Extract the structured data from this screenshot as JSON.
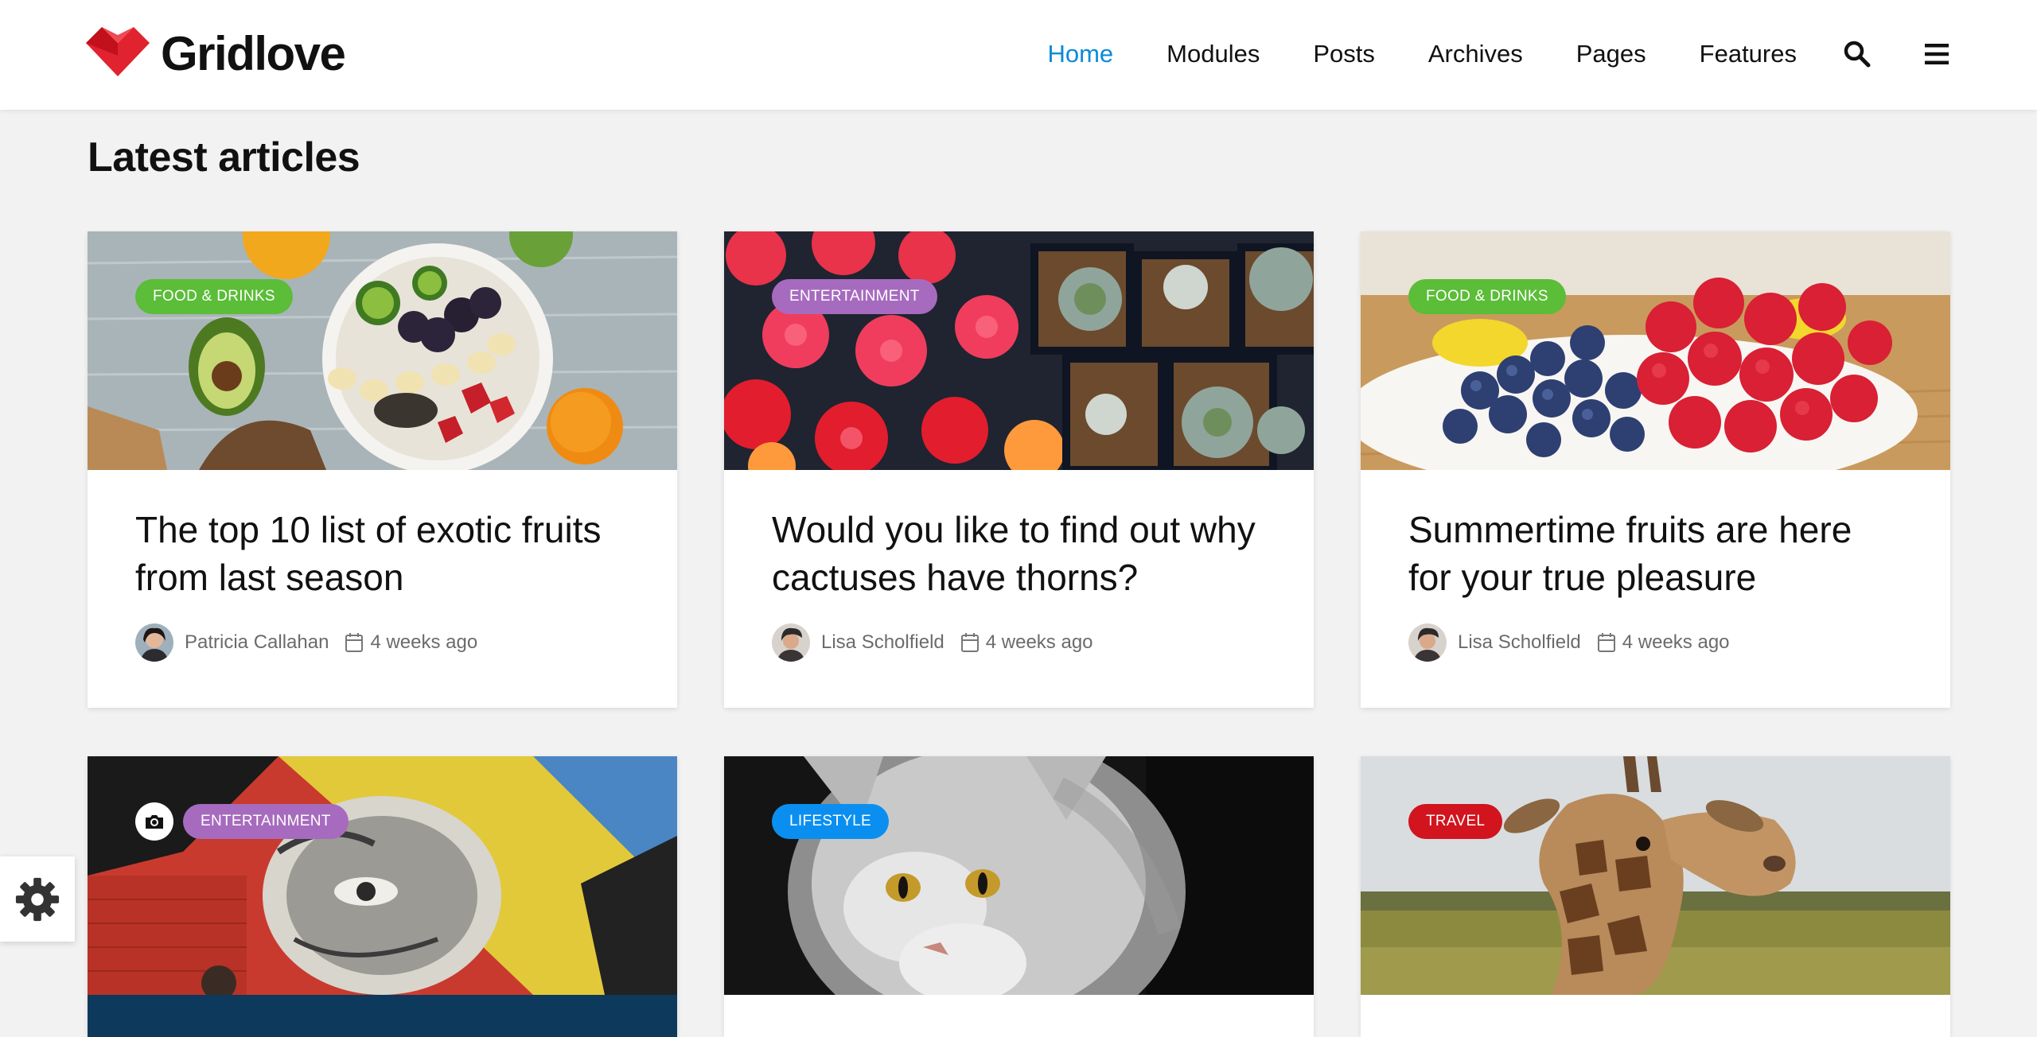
{
  "site": {
    "name": "Gridlove",
    "brand_color": "#e1222f"
  },
  "nav": {
    "items": [
      "Home",
      "Modules",
      "Posts",
      "Archives",
      "Pages",
      "Features"
    ],
    "active": "Home",
    "active_color": "#0a8ad8",
    "icons": [
      "search-icon",
      "hamburger-menu-icon"
    ]
  },
  "section": {
    "title": "Latest articles"
  },
  "cards": [
    {
      "category": "FOOD & DRINKS",
      "category_color": "#5bbd38",
      "title": "The top 10 list of exotic fruits from last season",
      "author": "Patricia Callahan",
      "date": "4 weeks ago",
      "image": "fruit-bowl"
    },
    {
      "category": "ENTERTAINMENT",
      "category_color": "#a66bbe",
      "title": "Would you like to find out why cactuses have thorns?",
      "author": "Lisa Scholfield",
      "date": "4 weeks ago",
      "image": "cactuses"
    },
    {
      "category": "FOOD & DRINKS",
      "category_color": "#5bbd38",
      "title": "Summertime fruits are here for your true pleasure",
      "author": "Lisa Scholfield",
      "date": "4 weeks ago",
      "image": "berries"
    },
    {
      "category": "ENTERTAINMENT",
      "category_color": "#a66bbe",
      "image": "street-art",
      "format_icon": "camera-icon"
    },
    {
      "category": "LIFESTYLE",
      "category_color": "#0a8ff0",
      "image": "cat"
    },
    {
      "category": "TRAVEL",
      "category_color": "#d1141e",
      "image": "giraffe"
    }
  ],
  "settings": {
    "icon": "gear-icon"
  }
}
